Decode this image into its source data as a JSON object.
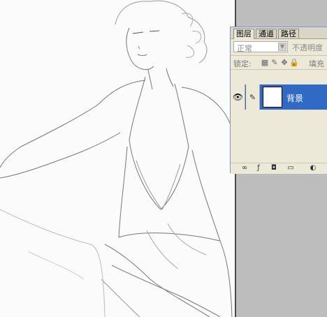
{
  "layers_panel": {
    "tabs": [
      "图层",
      "通道",
      "路径"
    ],
    "blend_mode": "正常",
    "opacity_label": "不透明度",
    "lock_label": "锁定:",
    "fill_label": "填充",
    "layer": {
      "name": "背景"
    }
  },
  "icons": [
    "eye-icon",
    "brush-icon",
    "lock-transparency-icon",
    "lock-paint-icon",
    "lock-move-icon",
    "lock-all-icon",
    "link-icon",
    "layer-style-icon",
    "mask-icon",
    "new-group-icon",
    "adjustment-layer-icon"
  ],
  "colors": {
    "selection": "#316ac5",
    "panel": "#ece9d8",
    "workspace": "#bdbdbd"
  }
}
